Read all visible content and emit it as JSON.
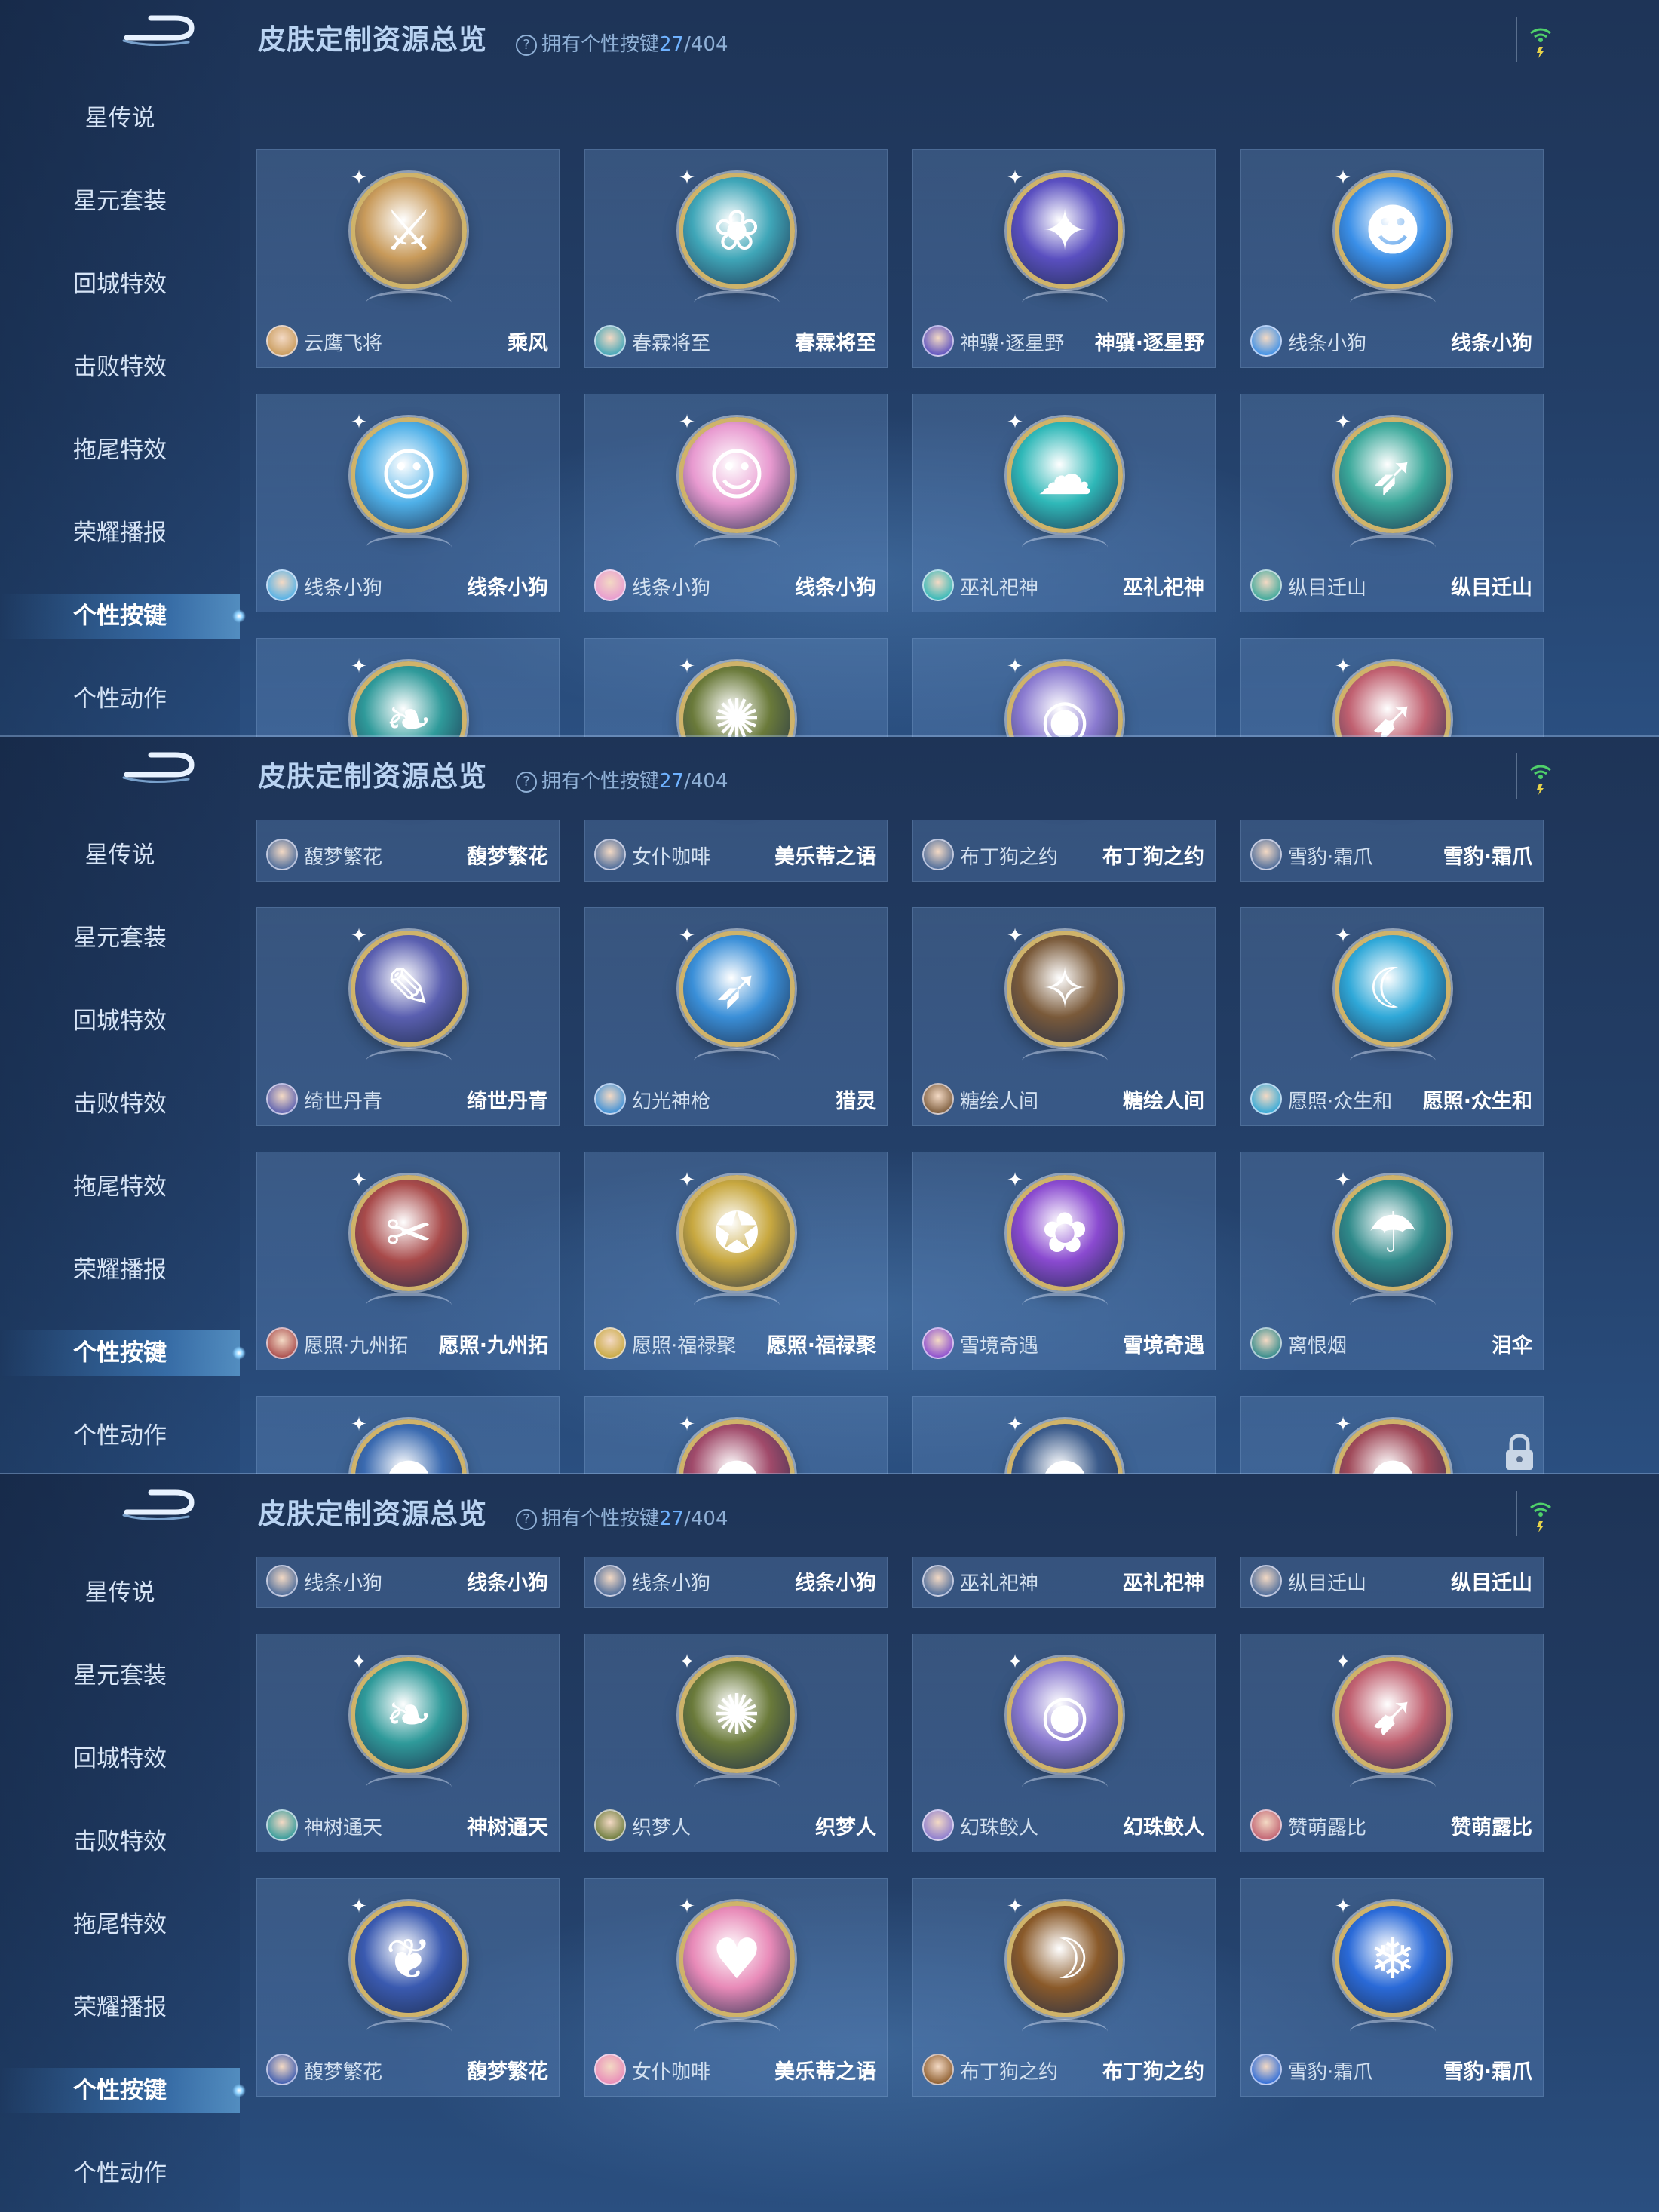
{
  "header": {
    "title": "皮肤定制资源总览",
    "info_prefix": "拥有个性按键",
    "owned": "27",
    "total_text": "/404"
  },
  "sidebar": {
    "items": [
      {
        "label": "星传说"
      },
      {
        "label": "星元套装"
      },
      {
        "label": "回城特效"
      },
      {
        "label": "击败特效"
      },
      {
        "label": "拖尾特效"
      },
      {
        "label": "荣耀播报"
      },
      {
        "label": "个性按键",
        "active": true
      },
      {
        "label": "个性动作"
      }
    ]
  },
  "panels": [
    {
      "rows": [
        [
          {
            "hero": "云鹰飞将",
            "skin": "乘风",
            "icon": "sword-wind-icon",
            "color": "#c89a5a"
          },
          {
            "hero": "春霖将至",
            "skin": "春霖将至",
            "icon": "water-blossom-icon",
            "color": "#3fa6b8"
          },
          {
            "hero": "神骥·逐星野",
            "skin": "神骥·逐星野",
            "icon": "star-spear-icon",
            "color": "#5a4fc0"
          },
          {
            "hero": "线条小狗",
            "skin": "线条小狗",
            "icon": "white-dog-icon",
            "color": "#3a8fe8"
          }
        ],
        [
          {
            "hero": "线条小狗",
            "skin": "线条小狗",
            "icon": "dog-duo-icon",
            "color": "#4fb0e8"
          },
          {
            "hero": "线条小狗",
            "skin": "线条小狗",
            "icon": "dog-pink-icon",
            "color": "#e89ad0"
          },
          {
            "hero": "巫礼祀神",
            "skin": "巫礼祀神",
            "icon": "spirit-cloud-icon",
            "color": "#2fb8b8"
          },
          {
            "hero": "纵目迁山",
            "skin": "纵目迁山",
            "icon": "jade-spear-icon",
            "color": "#3aa89a"
          }
        ],
        [
          {
            "hero": "",
            "skin": "",
            "icon": "tree-leaf-icon",
            "color": "#2f9a9a"
          },
          {
            "hero": "",
            "skin": "",
            "icon": "dragon-emblem-icon",
            "color": "#6a7a3a"
          },
          {
            "hero": "",
            "skin": "",
            "icon": "pearl-icon",
            "color": "#8a7ad0"
          },
          {
            "hero": "",
            "skin": "",
            "icon": "red-arrow-icon",
            "color": "#c06070"
          }
        ]
      ]
    },
    {
      "rows": [
        [
          {
            "hero": "馥梦繁花",
            "skin": "馥梦繁花",
            "icon": "blank-icon",
            "color": "#4a6a9a"
          },
          {
            "hero": "女仆咖啡",
            "skin": "美乐蒂之语",
            "icon": "blank-icon",
            "color": "#4a6a9a"
          },
          {
            "hero": "布丁狗之约",
            "skin": "布丁狗之约",
            "icon": "blank-icon",
            "color": "#4a6a9a"
          },
          {
            "hero": "雪豹·霜爪",
            "skin": "雪豹·霜爪",
            "icon": "blank-icon",
            "color": "#4a6a9a"
          }
        ],
        [
          {
            "hero": "绮世丹青",
            "skin": "绮世丹青",
            "icon": "ink-blade-icon",
            "color": "#5a5fb0"
          },
          {
            "hero": "幻光神枪",
            "skin": "猎灵",
            "icon": "fire-spear-icon",
            "color": "#3a8fd8"
          },
          {
            "hero": "糖绘人间",
            "skin": "糖绘人间",
            "icon": "candy-spear-icon",
            "color": "#7a5a3a"
          },
          {
            "hero": "愿照·众生和",
            "skin": "愿照·众生和",
            "icon": "crescent-wave-icon",
            "color": "#2fa8d8"
          }
        ],
        [
          {
            "hero": "愿照·九州拓",
            "skin": "愿照·九州拓",
            "icon": "red-blade-icon",
            "color": "#a84a4a"
          },
          {
            "hero": "愿照·福禄聚",
            "skin": "愿照·福禄聚",
            "icon": "golden-beast-icon",
            "color": "#c8a840"
          },
          {
            "hero": "雪境奇遇",
            "skin": "雪境奇遇",
            "icon": "purple-flower-icon",
            "color": "#8a4ad0"
          },
          {
            "hero": "离恨烟",
            "skin": "泪伞",
            "icon": "umbrella-icon",
            "color": "#2f8a8a"
          }
        ],
        [
          {
            "hero": "",
            "skin": "",
            "icon": "blue-orb-icon",
            "color": "#3a6ab0"
          },
          {
            "hero": "",
            "skin": "",
            "icon": "red-orb-icon",
            "color": "#a04a6a"
          },
          {
            "hero": "",
            "skin": "",
            "icon": "dark-orb-icon",
            "color": "#3a5a8a"
          },
          {
            "hero": "",
            "skin": "",
            "icon": "locked-orb-icon",
            "color": "#a04a5a"
          }
        ]
      ]
    },
    {
      "rows": [
        [
          {
            "hero": "线条小狗",
            "skin": "线条小狗",
            "icon": "blank-icon",
            "color": "#4a6a9a"
          },
          {
            "hero": "线条小狗",
            "skin": "线条小狗",
            "icon": "blank-icon",
            "color": "#4a6a9a"
          },
          {
            "hero": "巫礼祀神",
            "skin": "巫礼祀神",
            "icon": "blank-icon",
            "color": "#4a6a9a"
          },
          {
            "hero": "纵目迁山",
            "skin": "纵目迁山",
            "icon": "blank-icon",
            "color": "#4a6a9a"
          }
        ],
        [
          {
            "hero": "神树通天",
            "skin": "神树通天",
            "icon": "tree-leaf-icon",
            "color": "#2f9a9a"
          },
          {
            "hero": "织梦人",
            "skin": "织梦人",
            "icon": "dragon-emblem-icon",
            "color": "#6a7a3a"
          },
          {
            "hero": "幻珠鲛人",
            "skin": "幻珠鲛人",
            "icon": "pearl-icon",
            "color": "#8a7ad0"
          },
          {
            "hero": "赞萌露比",
            "skin": "赞萌露比",
            "icon": "red-arrow-icon",
            "color": "#c06070"
          }
        ],
        [
          {
            "hero": "馥梦繁花",
            "skin": "馥梦繁花",
            "icon": "golden-wing-icon",
            "color": "#3a5ab0"
          },
          {
            "hero": "女仆咖啡",
            "skin": "美乐蒂之语",
            "icon": "melody-icon",
            "color": "#e88ab8"
          },
          {
            "hero": "布丁狗之约",
            "skin": "布丁狗之约",
            "icon": "pudding-moon-icon",
            "color": "#8a5a2a"
          },
          {
            "hero": "雪豹·霜爪",
            "skin": "雪豹·霜爪",
            "icon": "frost-claw-icon",
            "color": "#2a6ad8"
          }
        ]
      ]
    }
  ]
}
